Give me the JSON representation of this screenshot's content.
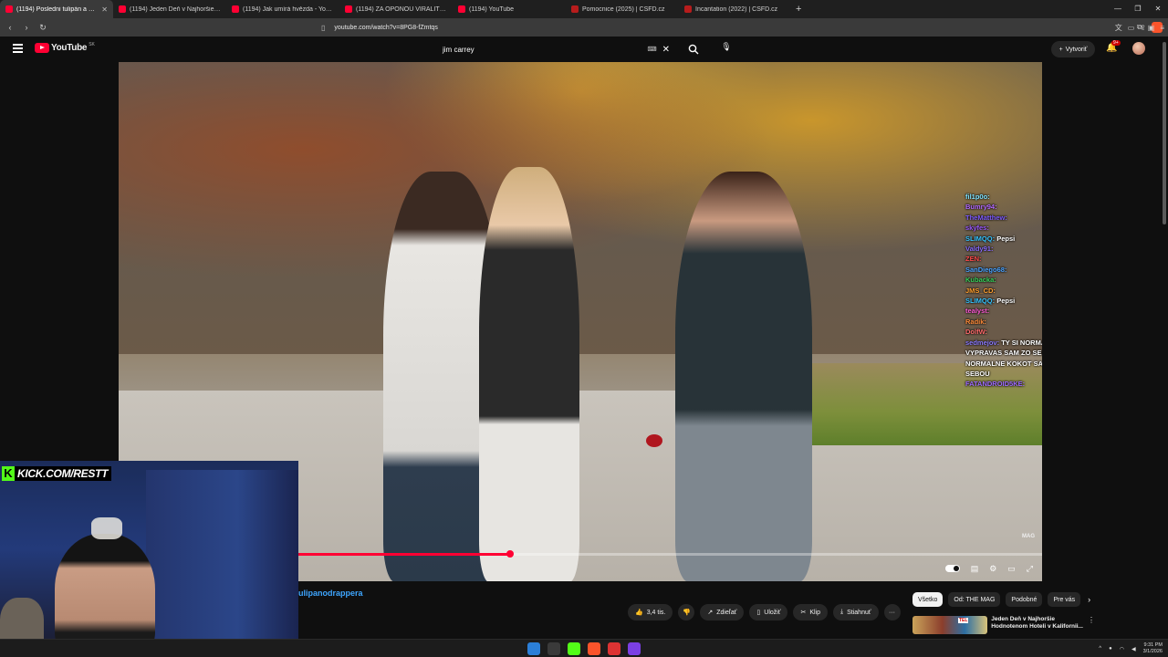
{
  "browser": {
    "tabs": [
      {
        "label": "(1194) Posledni tulipán a nežn",
        "type": "yt",
        "active": true
      },
      {
        "label": "(1194) Jeden Deň v Najhoršie Hodno",
        "type": "yt",
        "active": false
      },
      {
        "label": "(1194) Jak umírá hvězda - YouTube",
        "type": "yt",
        "active": false
      },
      {
        "label": "(1194) ZA OPONOU VIRALITY: MEL",
        "type": "yt",
        "active": false
      },
      {
        "label": "(1194) YouTube",
        "type": "yt",
        "active": false
      },
      {
        "label": "Pomocnice (2025) | ČSFD.cz",
        "type": "csfd",
        "active": false
      },
      {
        "label": "Incantation (2022) | ČSFD.cz",
        "type": "csfd",
        "active": false
      }
    ],
    "new_tab": "+",
    "url": "youtube.com/watch?v=8PG8-fZmtqs"
  },
  "youtube": {
    "logo_text": "YouTube",
    "country": "SK",
    "search_value": "jim carrey",
    "create_label": "Vytvoriť",
    "notif_badge": "9+"
  },
  "video": {
    "progress_fraction": 0.285,
    "watermark": "MAG",
    "chat": [
      {
        "user": "fil1p0o:",
        "color": "#7fe3ff",
        "msg": ""
      },
      {
        "user": "Bumry94:",
        "color": "#b46bff",
        "msg": ""
      },
      {
        "user": "TheMatthew:",
        "color": "#7d5bff",
        "msg": ""
      },
      {
        "user": "skyfes:",
        "color": "#9b59ff",
        "msg": ""
      },
      {
        "user": "SLIMQQ:",
        "color": "#36c4ff",
        "msg": "Pepsi"
      },
      {
        "user": "Valdy91:",
        "color": "#8a6cff",
        "msg": ""
      },
      {
        "user": "ZEN:",
        "color": "#ff4a4a",
        "msg": ""
      },
      {
        "user": "SanDiego68:",
        "color": "#4aa3ff",
        "msg": ""
      },
      {
        "user": "Kubacka:",
        "color": "#39d15a",
        "msg": ""
      },
      {
        "user": "JMS_CD:",
        "color": "#ff9f2e",
        "msg": ""
      },
      {
        "user": "SLIMQQ:",
        "color": "#36c4ff",
        "msg": "Pepsi"
      },
      {
        "user": "tealyst:",
        "color": "#ff5cd6",
        "msg": ""
      },
      {
        "user": "Radik:",
        "color": "#ff8c3a",
        "msg": ""
      },
      {
        "user": "DolfW:",
        "color": "#ff6b6b",
        "msg": ""
      },
      {
        "user": "sedmejov:",
        "color": "#8c7bff",
        "msg": "TY SI NORMALNE KOKOT SA VYPRAVAS SAM ZO SEBOU TY SI NORMALNE KOKOT SA VYPRAVAS SAM ZO SEBOU"
      },
      {
        "user": "FATANDROID5KE:",
        "color": "#9f6bff",
        "msg": ""
      }
    ]
  },
  "overlay": {
    "kick_k": "K",
    "kick_text": "KICK.COM/RESTT"
  },
  "below": {
    "title": "ulipanodrappera",
    "likes": "3,4 tis.",
    "share": "Zdieľať",
    "save": "Uložiť",
    "clip": "Klip",
    "download": "Stiahnuť",
    "more": "···",
    "chips": [
      "Všetko",
      "Od: THE MAG",
      "Podobné",
      "Pre vás"
    ],
    "rec_title": "Jeden Deň v Najhoršie Hodnotenom Hoteli v Kalifornii...",
    "rec_thumb_tag": "TEL"
  },
  "taskbar": {
    "time": "9:31 PM",
    "date": "3/1/2026"
  }
}
